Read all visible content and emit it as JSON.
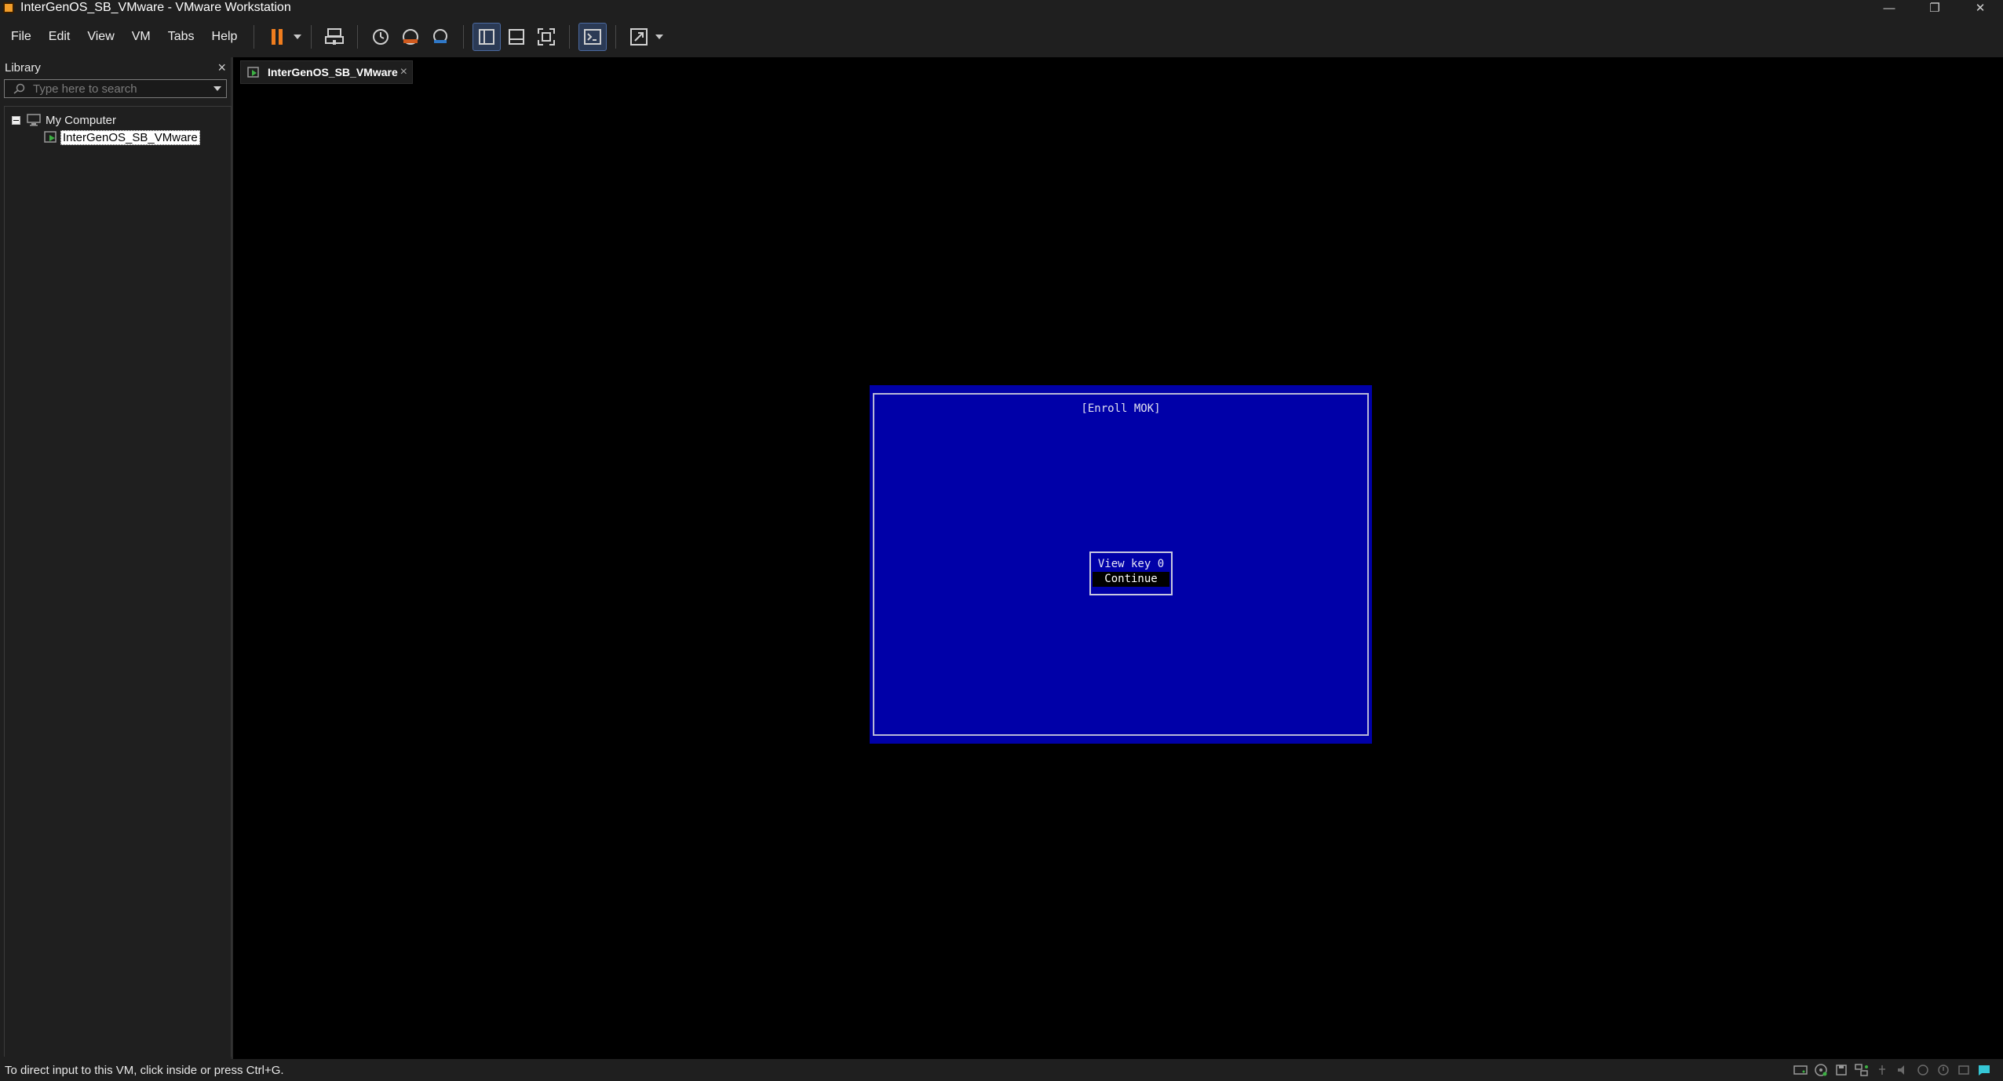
{
  "window": {
    "title": "InterGenOS_SB_VMware - VMware Workstation",
    "controls": {
      "minimize": "—",
      "restore": "❐",
      "close": "✕"
    }
  },
  "menu": [
    "File",
    "Edit",
    "View",
    "VM",
    "Tabs",
    "Help"
  ],
  "toolbar": {
    "icons": [
      "pause-icon",
      "dropdown-icon",
      "send-ctrl-alt-del-icon",
      "snapshot-icon",
      "revert-snapshot-icon",
      "snapshot-manager-icon",
      "show-library-icon",
      "thumbnail-bar-icon",
      "full-screen-icon",
      "console-view-icon",
      "stretch-guest-icon"
    ],
    "colors": {
      "pause": "#f07d1e",
      "active_bg": "#2b3a55"
    }
  },
  "library": {
    "title": "Library",
    "close": "×",
    "search_placeholder": "Type here to search",
    "tree": [
      {
        "label": "My Computer",
        "expanded": true
      },
      {
        "label": "InterGenOS_SB_VMware",
        "selected": true
      }
    ]
  },
  "tab": {
    "label": "InterGenOS_SB_VMware",
    "close": "×"
  },
  "vm_screen": {
    "title": "[Enroll MOK]",
    "menu_items": [
      {
        "label": "View key 0",
        "selected": false
      },
      {
        "label": "Continue",
        "selected": true
      }
    ],
    "colors": {
      "background": "#0000a8",
      "text": "#e0e0f0"
    }
  },
  "status": {
    "text": "To direct input to this VM, click inside or press Ctrl+G.",
    "icons": [
      "hard-disk-icon",
      "cd-dvd-icon",
      "floppy-icon",
      "network-icon",
      "usb-icon",
      "sound-icon",
      "printer-icon",
      "display-icon",
      "message-icon"
    ]
  }
}
